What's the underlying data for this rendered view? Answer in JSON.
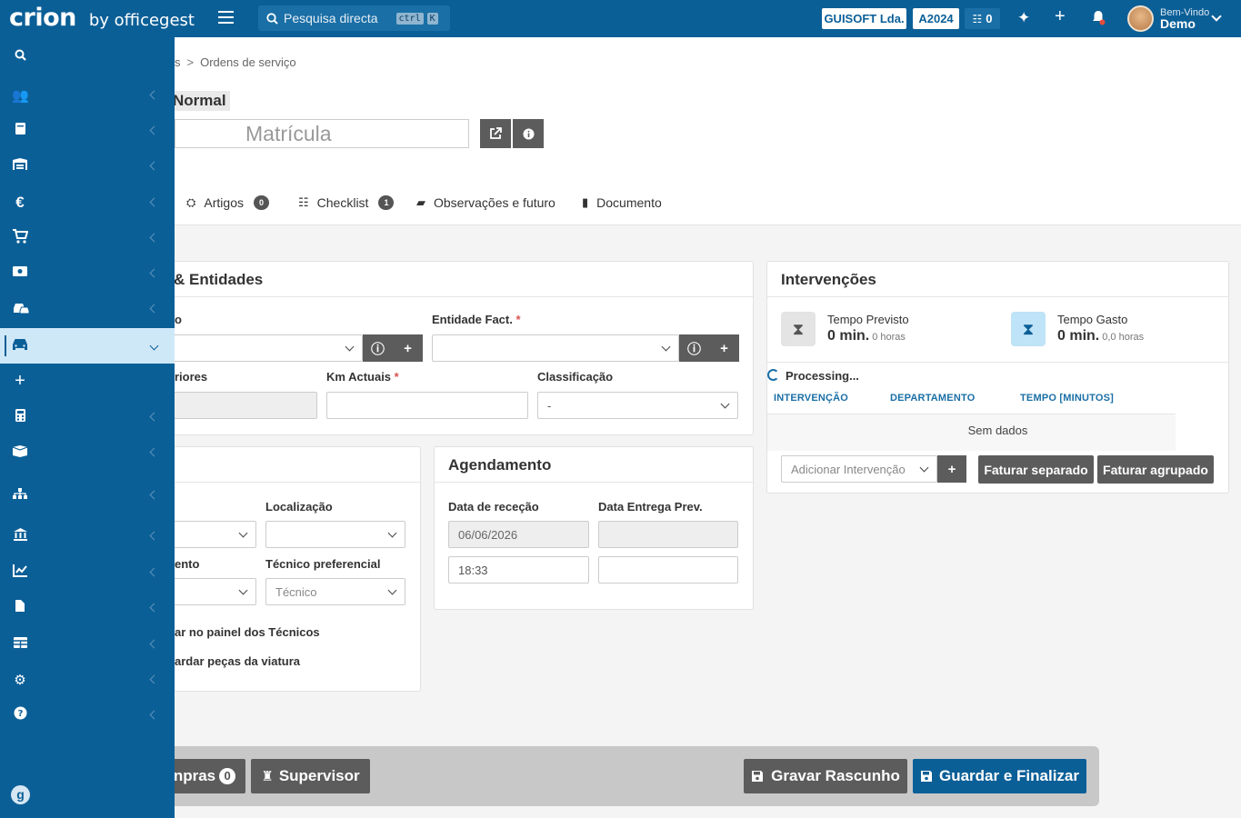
{
  "topbar": {
    "brand": "crion",
    "brand_suffix": "by officegest",
    "search_placeholder": "Pesquisa directa",
    "shortcut_key1": "ctrl",
    "shortcut_key2": "K",
    "company": "GUISOFT Lda.",
    "year": "A2024",
    "tasks_count": "0",
    "greeting": "Bem-Vindo",
    "user_name": "Demo"
  },
  "breadcrumb": {
    "parent_partial": "s",
    "current": "Ordens de serviço"
  },
  "header": {
    "priority": "Normal",
    "plate_placeholder": "Matrícula"
  },
  "tabs": [
    {
      "label": "Artigos",
      "count": "0"
    },
    {
      "label": "Checklist",
      "count": "1"
    },
    {
      "label": "Observações e futuro"
    },
    {
      "label": "Documento"
    }
  ],
  "entities_card": {
    "title_partial": "& Entidades",
    "label_partial_1": "o",
    "entity_fact_label": "Entidade Fact.",
    "label_partial_2": "riores",
    "km_label": "Km Actuais",
    "classification_label": "Classificação",
    "classification_value": "-"
  },
  "left_card": {
    "location_label": "Localização",
    "label_partial": "ento",
    "preferred_tech_label": "Técnico preferencial",
    "preferred_tech_placeholder": "Técnico",
    "check1_partial": "ar no painel dos Técnicos",
    "check2_partial": "ardar peças da viatura"
  },
  "schedule_card": {
    "title": "Agendamento",
    "reception_label": "Data de receção",
    "delivery_label": "Data Entrega Prev.",
    "reception_date": "06/06/2026",
    "reception_time": "18:33"
  },
  "interventions_card": {
    "title": "Intervenções",
    "planned_label": "Tempo Previsto",
    "planned_value": "0 min.",
    "planned_hours": "0 horas",
    "spent_label": "Tempo Gasto",
    "spent_value": "0 min.",
    "spent_hours": "0,0 horas",
    "processing": "Processing...",
    "col_intervention": "INTERVENÇÃO",
    "col_department": "DEPARTAMENTO",
    "col_time": "TEMPO [MINUTOS]",
    "empty": "Sem dados",
    "add_placeholder": "Adicionar Intervenção",
    "invoice_separate": "Faturar separado",
    "invoice_grouped": "Faturar agrupado"
  },
  "footer": {
    "purchases_partial": "npras",
    "purchases_count": "0",
    "supervisor": "Supervisor",
    "save_draft": "Gravar Rascunho",
    "save_finish": "Guardar e Finalizar"
  },
  "colors": {
    "primary": "#0b5f97",
    "active_sidebar": "#cfe8f7",
    "dark_button": "#5c5c5c"
  }
}
